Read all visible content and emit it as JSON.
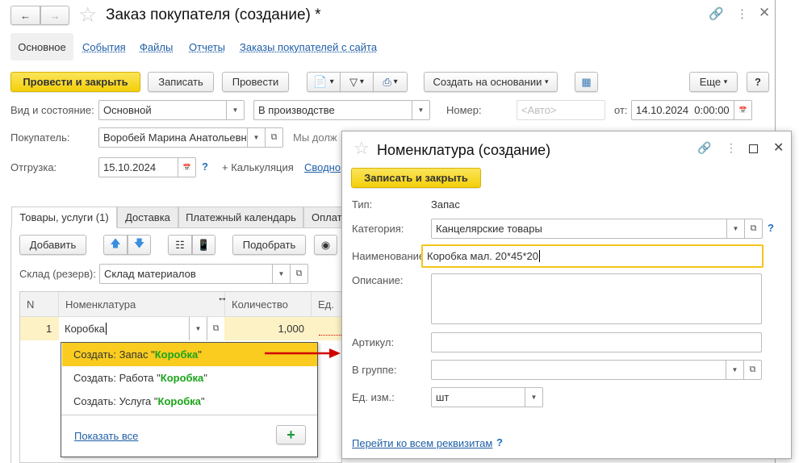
{
  "window": {
    "title": "Заказ покупателя (создание) *"
  },
  "nav": {
    "tabs": [
      "Основное",
      "События",
      "Файлы",
      "Отчеты",
      "Заказы покупателей с сайта"
    ]
  },
  "toolbar": {
    "post_close": "Провести и закрыть",
    "save": "Записать",
    "post": "Провести",
    "create_based": "Создать на основании",
    "more": "Еще",
    "help": "?"
  },
  "form": {
    "kind_label": "Вид и состояние:",
    "kind_value": "Основной",
    "state_value": "В производстве",
    "number_label": "Номер:",
    "number_placeholder": "<Авто>",
    "date_label": "от:",
    "date_value": "14.10.2024  0:00:00",
    "buyer_label": "Покупатель:",
    "buyer_value": "Воробей Марина Анатольевна",
    "debt_text": "Мы долж",
    "shipment_label": "Отгрузка:",
    "shipment_value": "15.10.2024",
    "help": "?",
    "calc": "+ Калькуляция",
    "summary_link": "Сводно"
  },
  "doc_tabs": [
    "Товары, услуги (1)",
    "Доставка",
    "Платежный календарь",
    "Оплат"
  ],
  "goods": {
    "add": "Добавить",
    "pick": "Подобрать",
    "warehouse_label": "Склад (резерв):",
    "warehouse_value": "Склад материалов",
    "columns": [
      "N",
      "Номенклатура",
      "Количество",
      "Ед."
    ],
    "rows": [
      {
        "n": "1",
        "item": "Коробка",
        "qty": "1,000"
      }
    ]
  },
  "popup": {
    "items": [
      {
        "prefix": "Создать: Запас \"",
        "name": "Коробка",
        "suffix": "\""
      },
      {
        "prefix": "Создать: Работа \"",
        "name": "Коробка",
        "suffix": "\""
      },
      {
        "prefix": "Создать: Услуга \"",
        "name": "Коробка",
        "suffix": "\""
      }
    ],
    "show_all": "Показать все"
  },
  "dialog": {
    "title": "Номенклатура (создание)",
    "save_close": "Записать и закрыть",
    "type_label": "Тип:",
    "type_value": "Запас",
    "category_label": "Категория:",
    "category_value": "Канцелярские товары",
    "name_label": "Наименование:",
    "name_value": "Коробка мал. 20*45*20",
    "desc_label": "Описание:",
    "desc_value": "",
    "article_label": "Артикул:",
    "article_value": "",
    "group_label": "В группе:",
    "group_value": "",
    "unit_label": "Ед. изм.:",
    "unit_value": "шт",
    "all_attrs_link": "Перейти ко всем реквизитам",
    "help": "?"
  },
  "colors": {
    "accent_yellow": "#f4cf0b",
    "highlight": "#f9cc1f",
    "link": "#1f5fa8",
    "arrow": "#d00000",
    "green": "#1aa51a"
  }
}
